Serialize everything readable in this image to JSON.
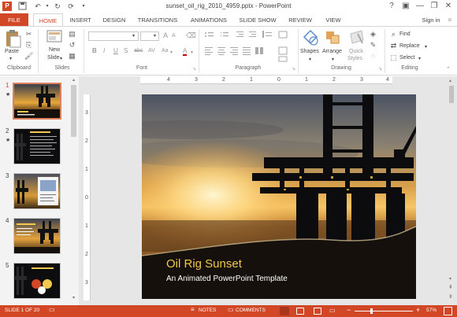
{
  "window": {
    "title": "sunset_oil_rig_2010_4959.pptx - PowerPoint",
    "help": "?",
    "minimize": "—",
    "restore": "❐",
    "close": "✕"
  },
  "tabs": [
    "FILE",
    "HOME",
    "INSERT",
    "DESIGN",
    "TRANSITIONS",
    "ANIMATIONS",
    "SLIDE SHOW",
    "REVIEW",
    "VIEW"
  ],
  "signin": "Sign in",
  "ribbon": {
    "clipboard": {
      "label": "Clipboard",
      "paste": "Paste"
    },
    "slides": {
      "label": "Slides",
      "new_slide_line1": "New",
      "new_slide_line2": "Slide"
    },
    "font": {
      "label": "Font",
      "bold": "B",
      "italic": "I",
      "underline": "U",
      "strike": "S",
      "shadow": "abc",
      "spacing": "AV",
      "case": "Aa",
      "color": "A",
      "grow": "A",
      "shrink": "A"
    },
    "paragraph": {
      "label": "Paragraph"
    },
    "drawing": {
      "label": "Drawing",
      "shapes": "Shapes",
      "arrange": "Arrange",
      "quick_styles_line1": "Quick",
      "quick_styles_line2": "Styles"
    },
    "editing": {
      "label": "Editing",
      "find": "Find",
      "replace": "Replace",
      "select": "Select"
    }
  },
  "ruler": {
    "h": [
      "4",
      "3",
      "2",
      "1",
      "0",
      "1",
      "2",
      "3",
      "4"
    ],
    "v": [
      "3",
      "2",
      "1",
      "0",
      "1",
      "2",
      "3"
    ]
  },
  "thumbnails": [
    {
      "num": "1",
      "star": "★",
      "title": "Oil Rig Sunset"
    },
    {
      "num": "2",
      "star": "★",
      "title": "Template Features"
    },
    {
      "num": "3",
      "star": "",
      "title": ""
    },
    {
      "num": "4",
      "star": "",
      "title": ""
    },
    {
      "num": "5",
      "star": "",
      "title": ""
    }
  ],
  "slide": {
    "title": "Oil Rig Sunset",
    "subtitle": "An Animated PowerPoint Template"
  },
  "status": {
    "slide": "SLIDE 1 OF 20",
    "notes": "NOTES",
    "comments": "COMMENTS",
    "zoom": "57%",
    "zoom_level": 0.57
  },
  "colors": {
    "accent": "#d24726",
    "title_gold": "#f2c94c"
  }
}
